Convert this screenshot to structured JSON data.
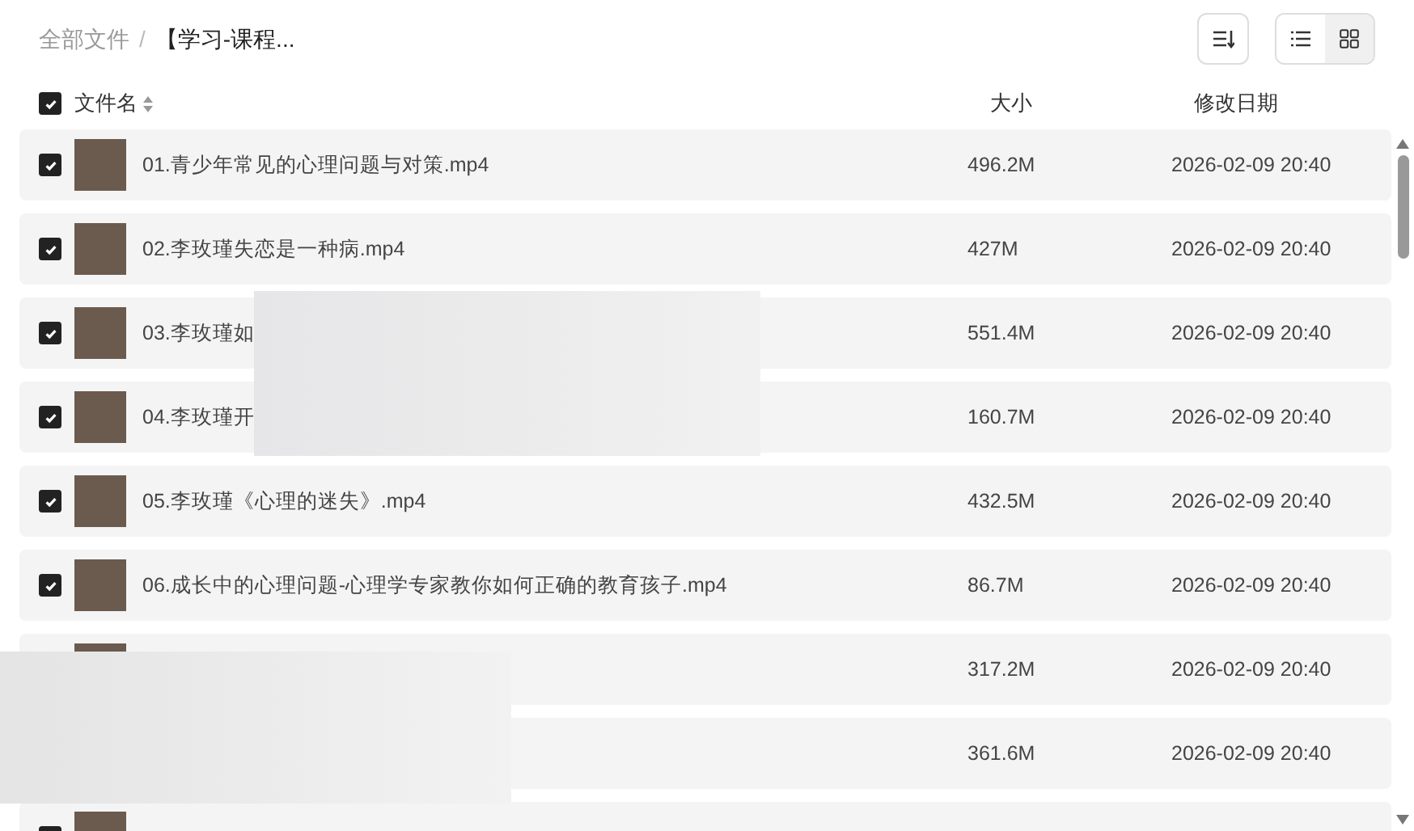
{
  "breadcrumb_separator": "/",
  "breadcrumb": [
    {
      "label": "全部文件",
      "selected": false
    },
    {
      "label": "【学习-课程...",
      "selected": true
    }
  ],
  "columns": {
    "name": "文件名",
    "size": "大小",
    "date": "修改日期"
  },
  "select_all": {
    "checked": true
  },
  "rows": [
    {
      "checked": true,
      "name": "01.青少年常见的心理问题与对策.mp4",
      "size": "496.2M",
      "date": "2026-02-09 20:40"
    },
    {
      "checked": true,
      "name": "02.李玫瑾失恋是一种病.mp4",
      "size": "427M",
      "date": "2026-02-09 20:40"
    },
    {
      "checked": true,
      "name": "03.李玫瑾如",
      "size": "551.4M",
      "date": "2026-02-09 20:40"
    },
    {
      "checked": true,
      "name": "04.李玫瑾开",
      "size": "160.7M",
      "date": "2026-02-09 20:40"
    },
    {
      "checked": true,
      "name": "05.李玫瑾《心理的迷失》.mp4",
      "size": "432.5M",
      "date": "2026-02-09 20:40"
    },
    {
      "checked": true,
      "name": "06.成长中的心理问题-心理学专家教你如何正确的教育孩子.mp4",
      "size": "86.7M",
      "date": "2026-02-09 20:40"
    },
    {
      "size": "317.2M",
      "date": "2026-02-09 20:40"
    },
    {
      "size": "361.6M",
      "date": "2026-02-09 20:40"
    },
    {
      "checked": true
    }
  ],
  "view_toggle": [
    {
      "kind": "list",
      "selected": true
    },
    {
      "kind": "grid",
      "selected": false
    }
  ]
}
